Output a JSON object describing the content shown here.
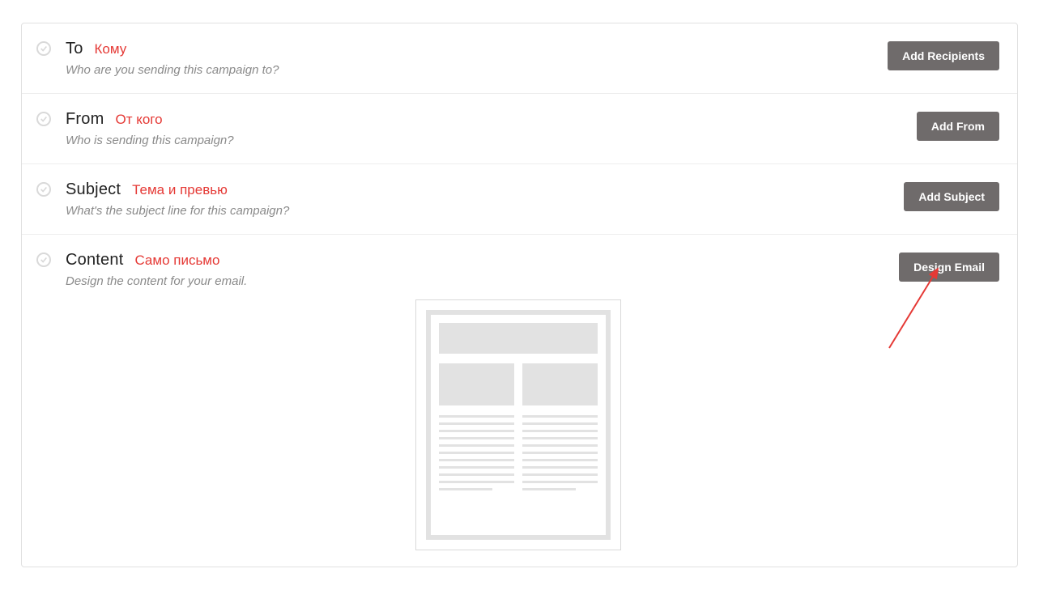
{
  "rows": [
    {
      "title": "To",
      "annotation": "Кому",
      "subtitle": "Who are you sending this campaign to?",
      "button": "Add Recipients"
    },
    {
      "title": "From",
      "annotation": "От кого",
      "subtitle": "Who is sending this campaign?",
      "button": "Add From"
    },
    {
      "title": "Subject",
      "annotation": "Тема и превью",
      "subtitle": "What's the subject line for this campaign?",
      "button": "Add Subject"
    },
    {
      "title": "Content",
      "annotation": "Само письмо",
      "subtitle": "Design the content for your email.",
      "button": "Design Email"
    }
  ]
}
